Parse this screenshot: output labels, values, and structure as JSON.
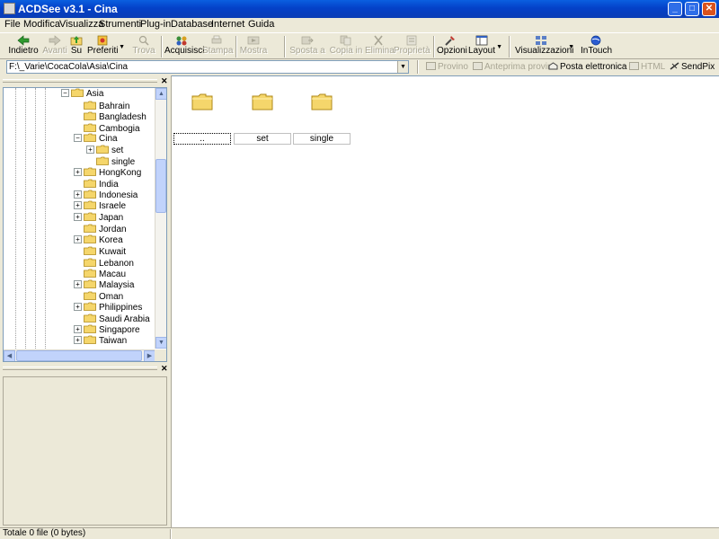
{
  "window": {
    "title": "ACDSee v3.1 - Cina",
    "minimize": "_",
    "maximize": "□",
    "close": "✕"
  },
  "menu": [
    "File",
    "Modifica",
    "Visualizza",
    "Strumenti",
    "Plug-in",
    "Database",
    "Internet",
    "Guida"
  ],
  "toolbar": {
    "back": "Indietro",
    "forward": "Avanti",
    "up": "Su",
    "favorites": "Preferiti",
    "find": "Trova",
    "acquire": "Acquisisci",
    "print": "Stampa",
    "slideshow": "Mostra",
    "move": "Sposta a",
    "copy": "Copia in",
    "delete": "Elimina",
    "properties": "Proprietà",
    "options": "Opzioni",
    "layout": "Layout",
    "views": "Visualizzazioni",
    "intouch": "InTouch"
  },
  "address": {
    "value": "F:\\_Varie\\CocaCola\\Asia\\Cina"
  },
  "actionbar": {
    "preview": "Provino",
    "print_preview": "Anteprima provino",
    "email": "Posta elettronica",
    "html": "HTML",
    "sendpix": "SendPix"
  },
  "tree": {
    "root": "Asia",
    "items": [
      {
        "label": "Bahrain",
        "expander": ""
      },
      {
        "label": "Bangladesh",
        "expander": ""
      },
      {
        "label": "Cambogia",
        "expander": ""
      },
      {
        "label": "Cina",
        "expander": "−"
      },
      {
        "label": "HongKong",
        "expander": "+"
      },
      {
        "label": "India",
        "expander": ""
      },
      {
        "label": "Indonesia",
        "expander": "+"
      },
      {
        "label": "Israele",
        "expander": "+"
      },
      {
        "label": "Japan",
        "expander": "+"
      },
      {
        "label": "Jordan",
        "expander": ""
      },
      {
        "label": "Korea",
        "expander": "+"
      },
      {
        "label": "Kuwait",
        "expander": ""
      },
      {
        "label": "Lebanon",
        "expander": ""
      },
      {
        "label": "Macau",
        "expander": ""
      },
      {
        "label": "Malaysia",
        "expander": "+"
      },
      {
        "label": "Oman",
        "expander": ""
      },
      {
        "label": "Philippines",
        "expander": "+"
      },
      {
        "label": "Saudi Arabia",
        "expander": ""
      },
      {
        "label": "Singapore",
        "expander": "+"
      },
      {
        "label": "Taiwan",
        "expander": "+"
      }
    ],
    "children": [
      {
        "label": "set",
        "expander": "+"
      },
      {
        "label": "single",
        "expander": ""
      }
    ]
  },
  "files": [
    {
      "name": "..",
      "selected": true
    },
    {
      "name": "set",
      "selected": false
    },
    {
      "name": "single",
      "selected": false
    }
  ],
  "status": {
    "text": "Totale 0 file (0 bytes)"
  },
  "colors": {
    "titlebar": "#0a5fe0",
    "folder": "#f5d66b",
    "folder_edge": "#b08a1a",
    "panel": "#ece9d8"
  }
}
